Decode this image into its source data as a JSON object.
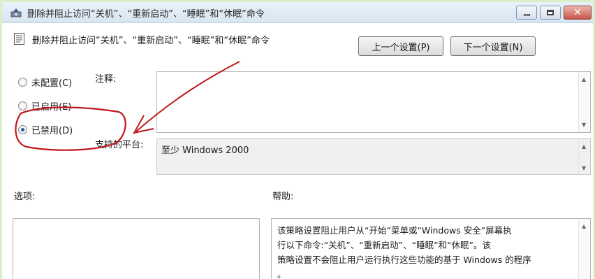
{
  "window": {
    "title": "删除并阻止访问“关机”、“重新启动”、“睡眠”和“休眠”命令",
    "controls": {
      "minimize_icon": "minimize-icon",
      "maximize_icon": "maximize-icon",
      "close_icon": "close-icon"
    }
  },
  "header": {
    "policy_name": "删除并阻止访问“关机”、“重新启动”、“睡眠”和“休眠”命令",
    "prev_button": "上一个设置(P)",
    "next_button": "下一个设置(N)"
  },
  "state_options": [
    {
      "label": "未配置(C)",
      "checked": false
    },
    {
      "label": "已启用(E)",
      "checked": false
    },
    {
      "label": "已禁用(D)",
      "checked": true
    }
  ],
  "comment": {
    "label": "注释:",
    "value": ""
  },
  "supported": {
    "label": "支持的平台:",
    "value": "至少 Windows 2000"
  },
  "options": {
    "label": "选项:"
  },
  "help": {
    "label": "帮助:",
    "lines": [
      "该策略设置阻止用户从“开始”菜单或“Windows 安全”屏幕执",
      "行以下命令:“关机”、“重新启动”、“睡眠”和“休眠”。该",
      "策略设置不会阻止用户运行执行这些功能的基于 Windows 的程序",
      "。"
    ]
  },
  "colors": {
    "annotation": "#c0161b",
    "frame": "#d9efc6",
    "title_bar": "#dfe9f3"
  }
}
